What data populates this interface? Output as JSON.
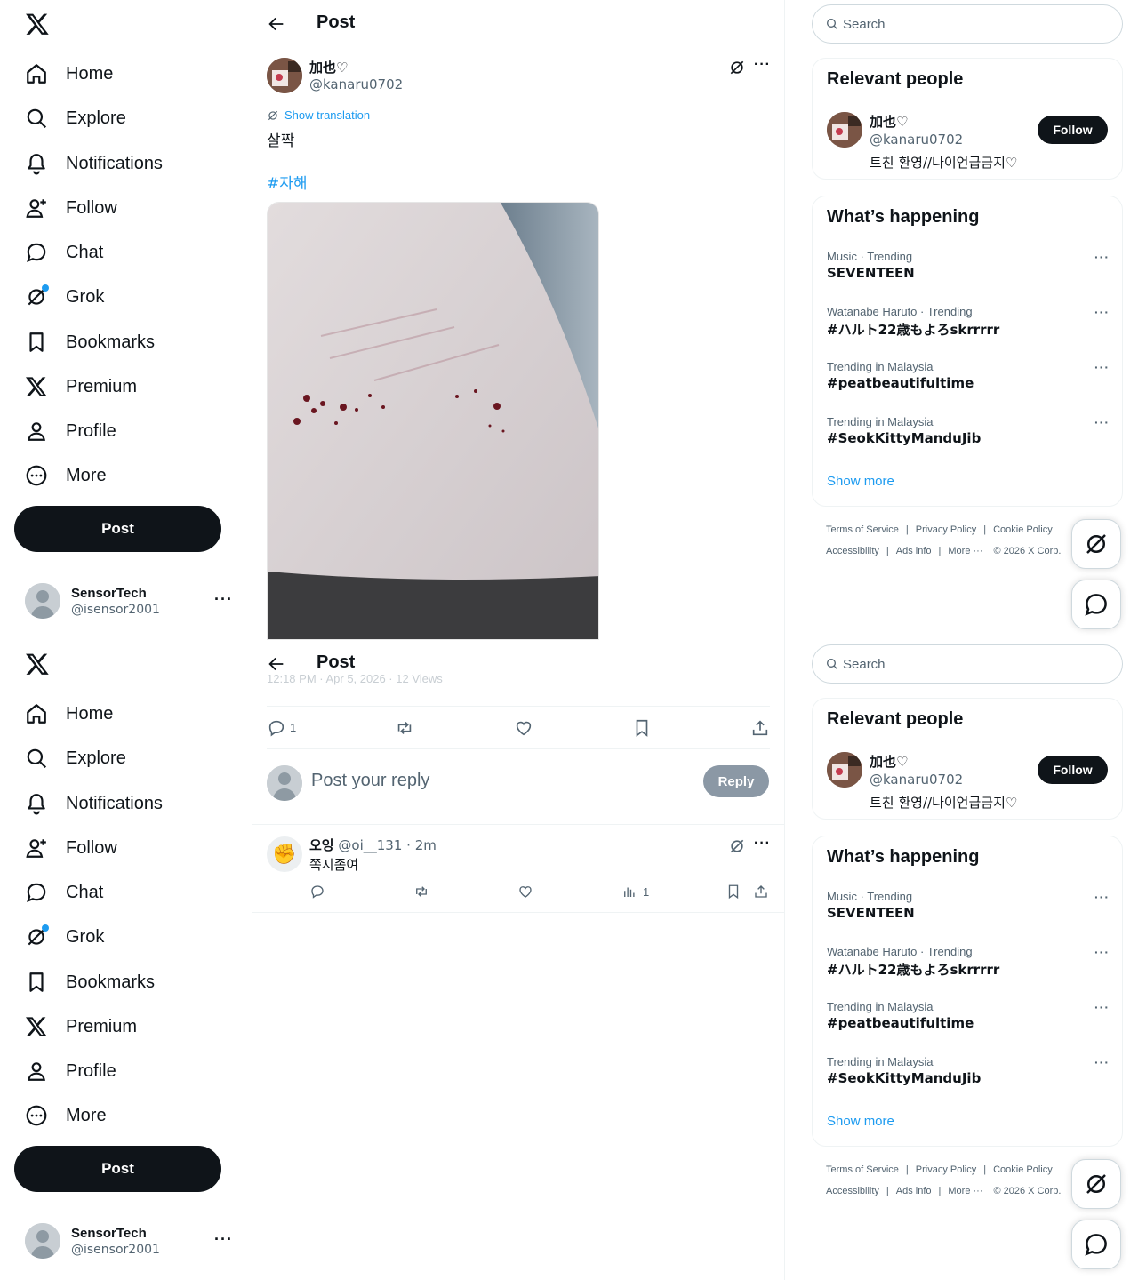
{
  "nav": {
    "items": [
      {
        "label": "Home",
        "icon": "home-icon"
      },
      {
        "label": "Explore",
        "icon": "search-icon"
      },
      {
        "label": "Notifications",
        "icon": "bell-icon"
      },
      {
        "label": "Follow",
        "icon": "person-plus-icon"
      },
      {
        "label": "Chat",
        "icon": "chat-bubble-icon"
      },
      {
        "label": "Grok",
        "icon": "grok-icon"
      },
      {
        "label": "Bookmarks",
        "icon": "bookmark-icon"
      },
      {
        "label": "Premium",
        "icon": "x-logo-icon"
      },
      {
        "label": "Profile",
        "icon": "person-icon"
      },
      {
        "label": "More",
        "icon": "more-circle-icon"
      }
    ],
    "post_button": "Post",
    "account": {
      "name": "SensorTech",
      "handle": "@isensor2001",
      "more": "···"
    }
  },
  "main": {
    "title": "Post",
    "post": {
      "author_name": "加也♡",
      "author_handle": "@kanaru0702",
      "show_translation": "Show translation",
      "text": "살짝",
      "hashtag": "#자해",
      "meta": "12:18 PM · Apr 5, 2026 · 12 Views",
      "reply_count": "1"
    },
    "reply": {
      "placeholder": "Post your reply",
      "button": "Reply"
    },
    "comment": {
      "author": "오잉",
      "handle": "@oi__131",
      "time": "· 2m",
      "text": "쪽지좀여",
      "avatar_emoji": "✊",
      "views": "1"
    }
  },
  "right": {
    "search_placeholder": "Search",
    "relevant": {
      "title": "Relevant people",
      "name": "加也♡",
      "handle": "@kanaru0702",
      "bio": "트친 환영//나이언급금지♡",
      "follow": "Follow"
    },
    "happening": {
      "title": "What’s happening",
      "trends": [
        {
          "meta": "Music · Trending",
          "name": "SEVENTEEN"
        },
        {
          "meta": "Watanabe Haruto · Trending",
          "name": "#ハルト22歳もよろskrrrrr"
        },
        {
          "meta": "Trending in Malaysia",
          "name": "#peatbeautifultime"
        },
        {
          "meta": "Trending in Malaysia",
          "name": "#SeokKittyManduJib"
        }
      ],
      "show_more": "Show more"
    },
    "footer": {
      "line1": [
        "Terms of Service",
        "Privacy Policy",
        "Cookie Policy"
      ],
      "line2": [
        "Accessibility",
        "Ads info",
        "More ···",
        "© 2026 X Corp."
      ]
    }
  },
  "colors": {
    "accent": "#1d9bf0",
    "text": "#0f1419",
    "muted": "#536471",
    "border": "#eff3f4"
  }
}
